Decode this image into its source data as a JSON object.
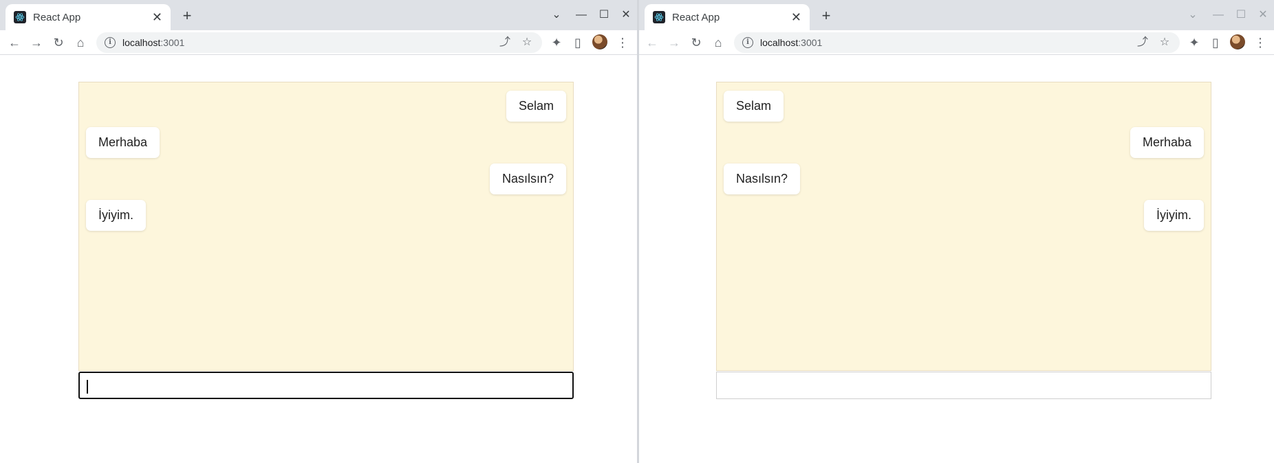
{
  "left_window": {
    "tab": {
      "title": "React App",
      "close_icon": "close-icon"
    },
    "new_tab_icon": "plus-icon",
    "window_controls": [
      "chevron-down-icon",
      "minimize-icon",
      "maximize-icon",
      "close-icon"
    ],
    "nav": {
      "back_enabled": true,
      "forward_enabled": true
    },
    "address": {
      "host": "localhost",
      "port": ":3001"
    },
    "chat": {
      "messages": [
        {
          "text": "Selam",
          "side": "right"
        },
        {
          "text": "Merhaba",
          "side": "left"
        },
        {
          "text": "Nasılsın?",
          "side": "right"
        },
        {
          "text": "İyiyim.",
          "side": "left"
        }
      ],
      "input": {
        "value": "",
        "focused": true
      }
    }
  },
  "right_window": {
    "tab": {
      "title": "React App",
      "close_icon": "close-icon"
    },
    "new_tab_icon": "plus-icon",
    "window_controls": [
      "chevron-down-icon",
      "minimize-icon",
      "maximize-icon",
      "close-icon"
    ],
    "nav": {
      "back_enabled": false,
      "forward_enabled": false
    },
    "address": {
      "host": "localhost",
      "port": ":3001"
    },
    "chat": {
      "messages": [
        {
          "text": "Selam",
          "side": "left"
        },
        {
          "text": "Merhaba",
          "side": "right"
        },
        {
          "text": "Nasılsın?",
          "side": "left"
        },
        {
          "text": "İyiyim.",
          "side": "right"
        }
      ],
      "input": {
        "value": "",
        "focused": false
      }
    }
  },
  "colors": {
    "chat_background": "#fdf6dc",
    "tabstrip": "#dee1e6",
    "bubble": "#ffffff"
  }
}
